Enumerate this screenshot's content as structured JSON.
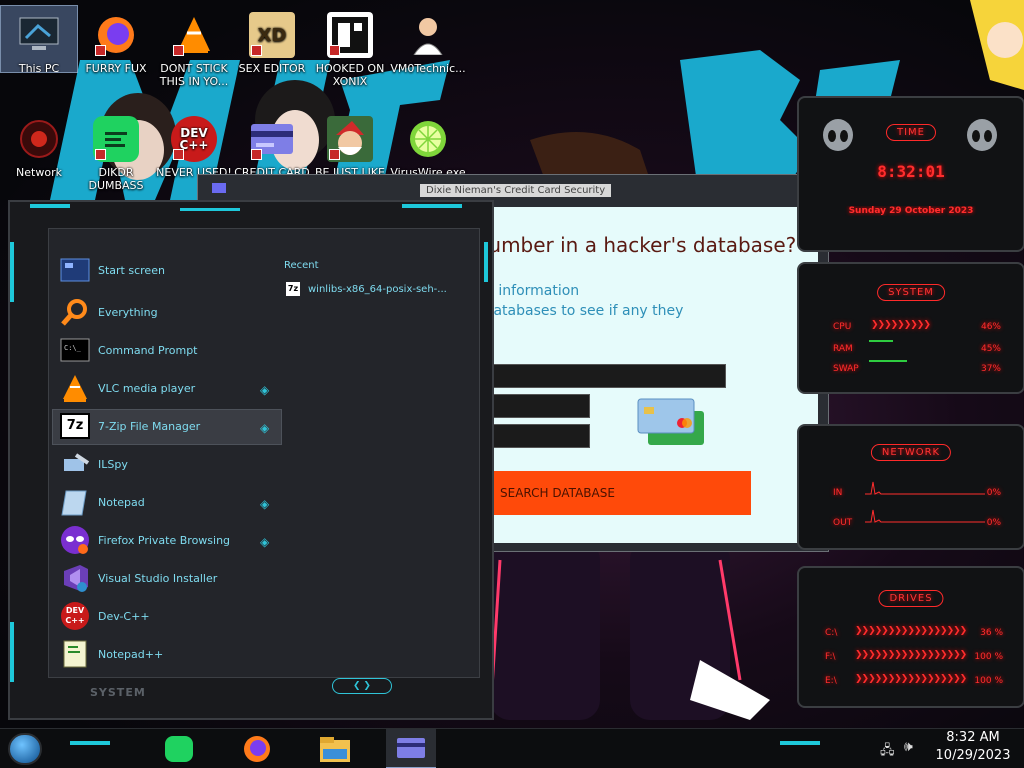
{
  "desktop": {
    "icons": [
      {
        "label": "This PC",
        "icon": "monitor-icon"
      },
      {
        "label": "FURRY FUX",
        "icon": "firefox-icon"
      },
      {
        "label": "DONT STICK THIS IN YO...",
        "icon": "vlc-icon"
      },
      {
        "label": "SEX EDITOR",
        "icon": "xd-icon"
      },
      {
        "label": "HOOKED ON XONIX",
        "icon": "xonix-icon"
      },
      {
        "label": "VM0Technic...",
        "icon": "doctor-icon"
      },
      {
        "label": "Network",
        "icon": "network-icon"
      },
      {
        "label": "DIKDR DUMBASS",
        "icon": "chat-icon"
      },
      {
        "label": "NEVER USED!",
        "icon": "devcpp-icon"
      },
      {
        "label": "CREDIT CARD",
        "icon": "credit-card-icon"
      },
      {
        "label": "BE JUST LIKE",
        "icon": "santa-icon"
      },
      {
        "label": "VirusWire.exe",
        "icon": "lime-icon"
      }
    ]
  },
  "cc_window": {
    "title": "Dixie Nieman's Credit Card Security",
    "heading": "Is your credit card number in a hacker's database?",
    "sub1": "All you need to do is enter its information",
    "sub2": "and we search all of hacker databases to see if any they",
    "button": "SEARCH DATABASE"
  },
  "start_menu": {
    "recent_header": "Recent",
    "recent_items": [
      "winlibs-x86_64-posix-seh-..."
    ],
    "items": [
      {
        "label": "Start screen",
        "icon": "start-screen-icon",
        "pin": false
      },
      {
        "label": "Everything",
        "icon": "search-icon",
        "pin": false
      },
      {
        "label": "Command Prompt",
        "icon": "terminal-icon",
        "pin": false
      },
      {
        "label": "VLC media player",
        "icon": "vlc-icon",
        "pin": true
      },
      {
        "label": "7-Zip File Manager",
        "icon": "7zip-icon",
        "pin": true
      },
      {
        "label": "ILSpy",
        "icon": "ilspy-icon",
        "pin": false
      },
      {
        "label": "Notepad",
        "icon": "notepad-icon",
        "pin": true
      },
      {
        "label": "Firefox Private Browsing",
        "icon": "private-browsing-icon",
        "pin": true
      },
      {
        "label": "Visual Studio Installer",
        "icon": "visual-studio-icon",
        "pin": false
      },
      {
        "label": "Dev-C++",
        "icon": "devcpp-icon",
        "pin": false
      },
      {
        "label": "Notepad++",
        "icon": "notepadpp-icon",
        "pin": false
      }
    ],
    "footer": "SYSTEM"
  },
  "gadgets": {
    "time": {
      "header": "TIME",
      "clock": "8:32:01",
      "date": "Sunday 29 October 2023"
    },
    "system": {
      "header": "SYSTEM",
      "rows": [
        {
          "label": "CPU",
          "value": "46%"
        },
        {
          "label": "RAM",
          "value": "45%"
        },
        {
          "label": "SWAP",
          "value": "37%"
        }
      ]
    },
    "network": {
      "header": "NETWORK",
      "rows": [
        {
          "label": "IN",
          "value": "0%"
        },
        {
          "label": "OUT",
          "value": "0%"
        }
      ]
    },
    "drives": {
      "header": "DRIVES",
      "rows": [
        {
          "label": "C:\\",
          "value": "36 %"
        },
        {
          "label": "F:\\",
          "value": "100 %"
        },
        {
          "label": "E:\\",
          "value": "100 %"
        }
      ]
    }
  },
  "taskbar": {
    "time": "8:32 AM",
    "date": "10/29/2023",
    "apps": [
      "chat-icon",
      "firefox-icon",
      "file-explorer-icon",
      "credit-card-icon"
    ]
  }
}
